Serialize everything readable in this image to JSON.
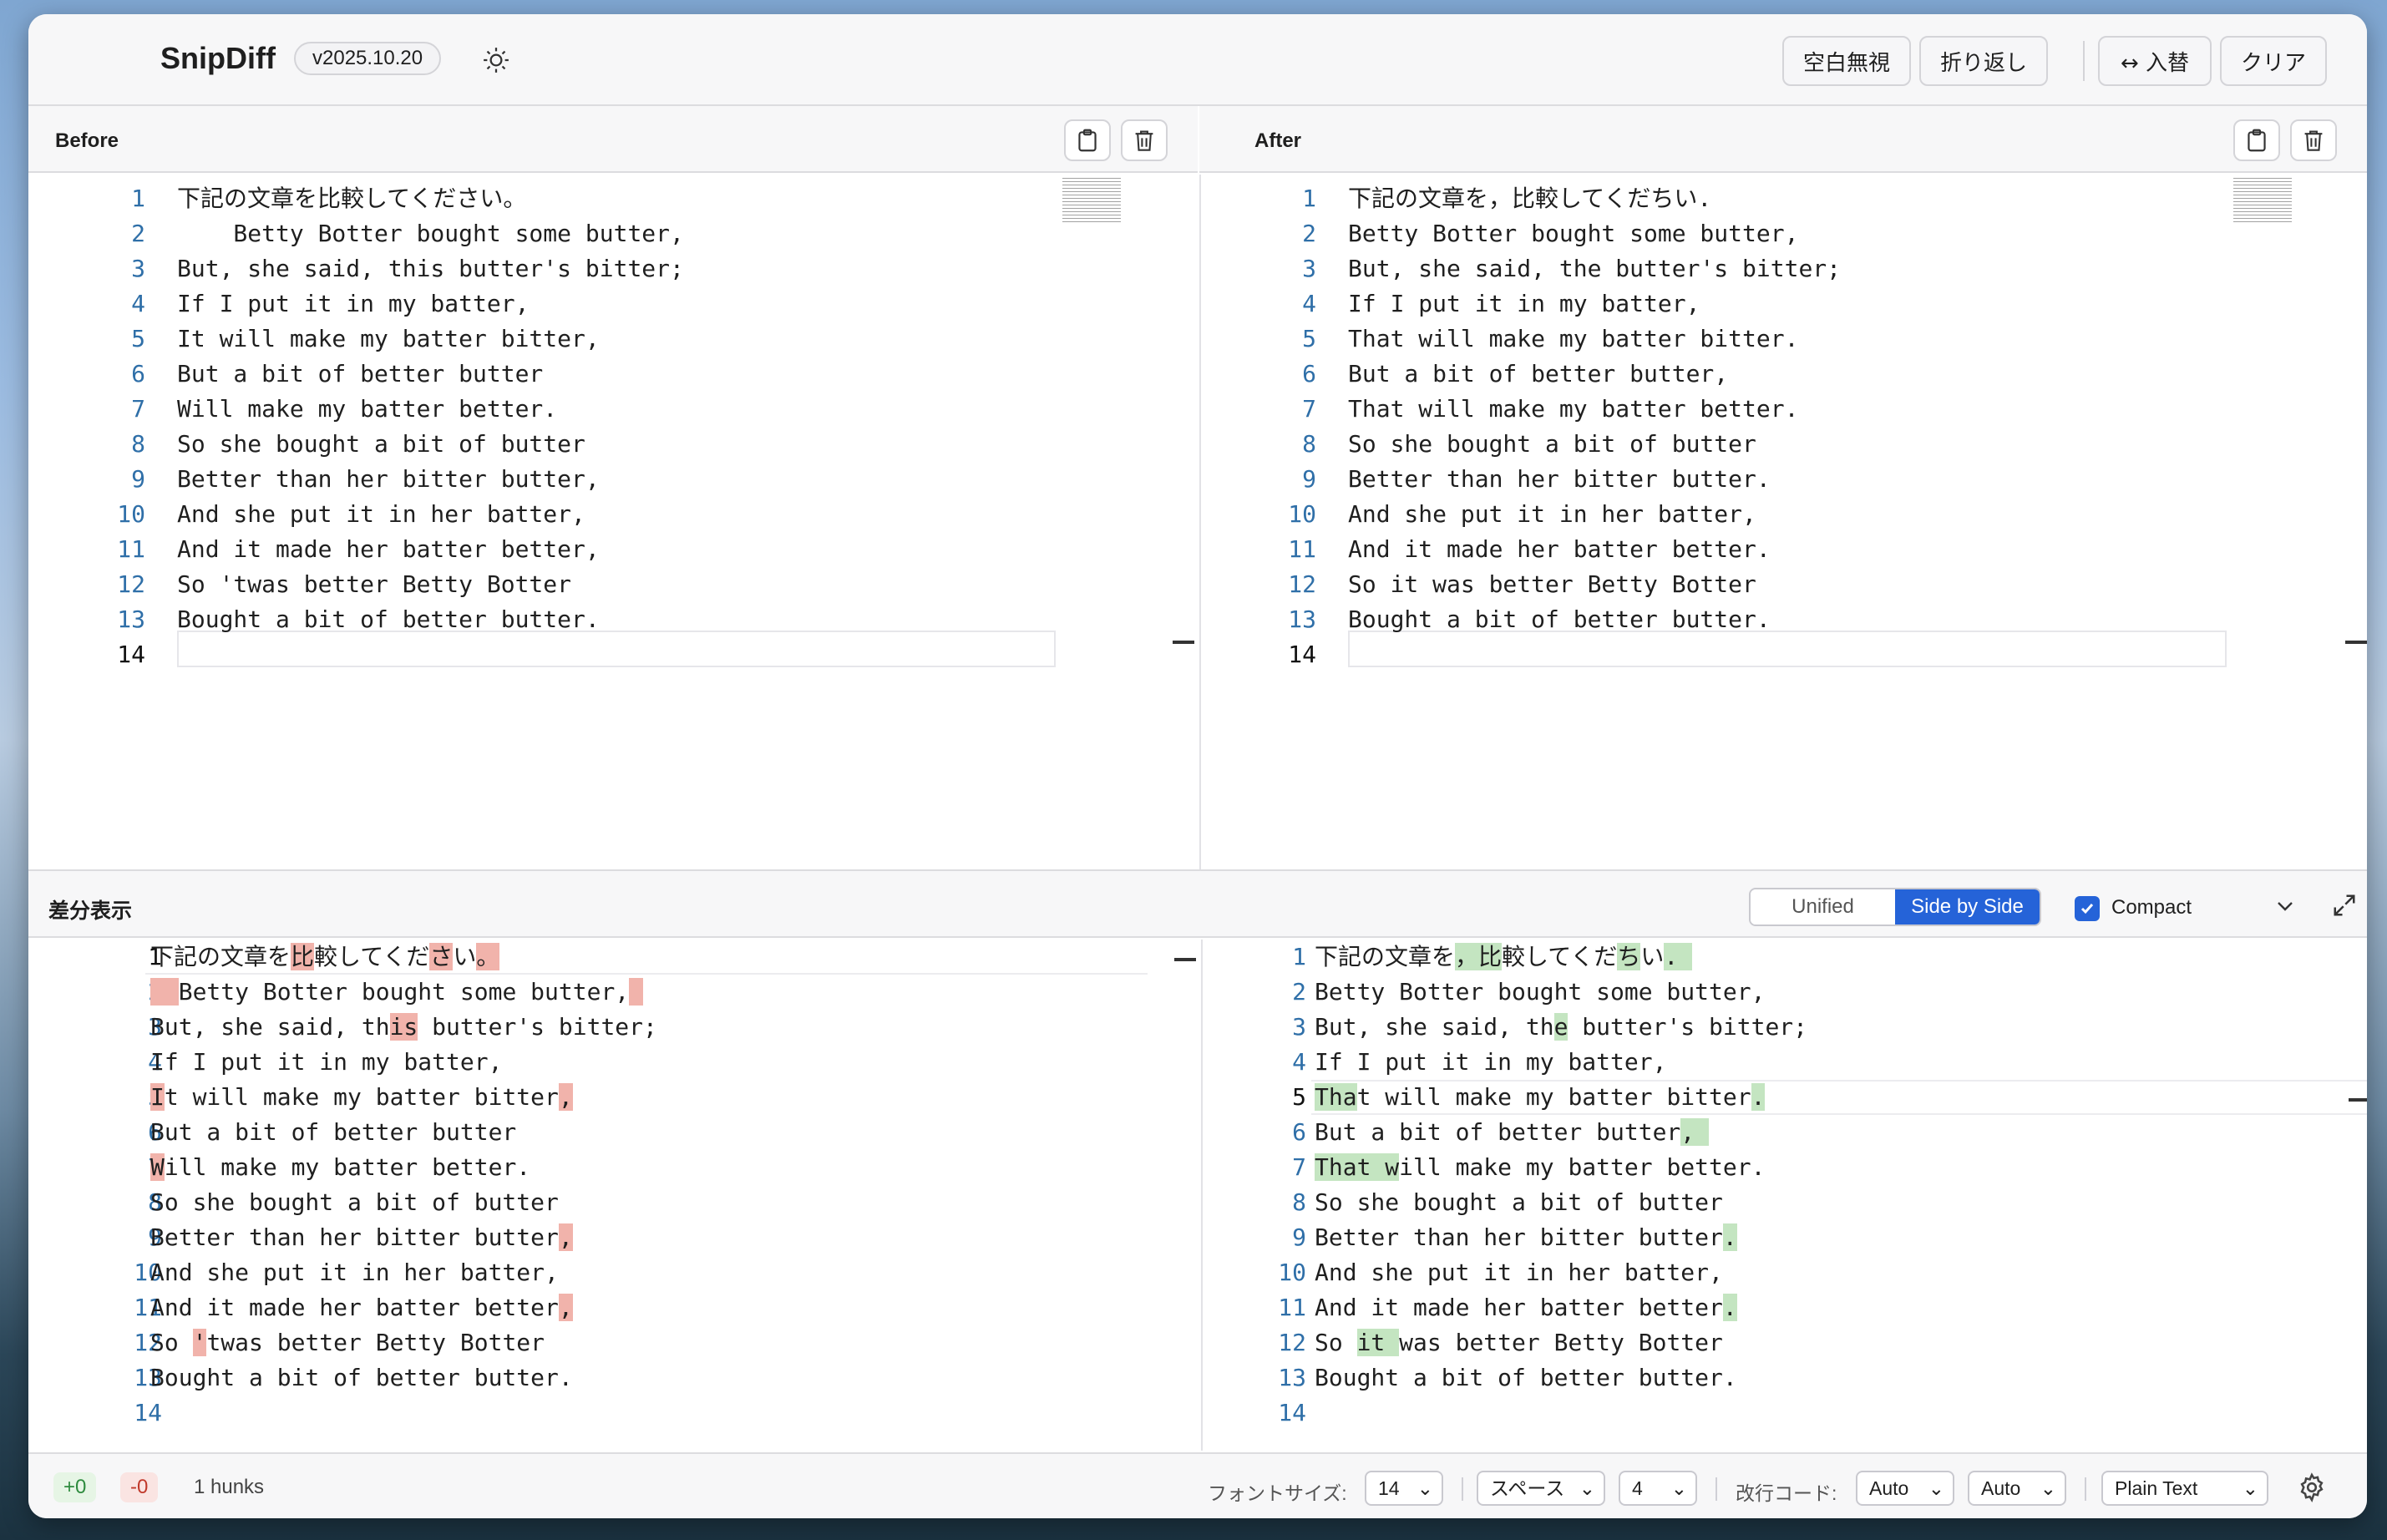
{
  "app": {
    "title": "SnipDiff",
    "version": "v2025.10.20"
  },
  "toolbar": {
    "ignore_whitespace": "空白無視",
    "wrap": "折り返し",
    "swap": "↔ 入替",
    "clear": "クリア"
  },
  "before": {
    "title": "Before",
    "lines": [
      "下記の文章を比較してください。",
      "    Betty Botter bought some butter,",
      "But, she said, this butter's bitter;",
      "If I put it in my batter,",
      "It will make my batter bitter,",
      "But a bit of better butter",
      "Will make my batter better.",
      "So she bought a bit of butter",
      "Better than her bitter butter,",
      "And she put it in her batter,",
      "And it made her batter better,",
      "So 'twas better Betty Botter",
      "Bought a bit of better butter.",
      ""
    ]
  },
  "after": {
    "title": "After",
    "lines": [
      "下記の文章を，比較してくだちい.",
      "Betty Botter bought some butter,",
      "But, she said, the butter's bitter;",
      "If I put it in my batter,",
      "That will make my batter bitter.",
      "But a bit of better butter,",
      "That will make my batter better.",
      "So she bought a bit of butter",
      "Better than her bitter butter.",
      "And she put it in her batter,",
      "And it made her batter better.",
      "So it was better Betty Botter",
      "Bought a bit of better butter.",
      ""
    ]
  },
  "diff": {
    "title": "差分表示",
    "mode_unified": "Unified",
    "mode_side": "Side by Side",
    "compact_label": "Compact",
    "left": [
      [
        [
          "下記の文章を",
          ""
        ],
        [
          "比",
          "d"
        ],
        [
          "較してくだ",
          ""
        ],
        [
          "さ",
          "d"
        ],
        [
          "い",
          ""
        ],
        [
          "。",
          "d"
        ]
      ],
      [
        [
          "  ",
          "d"
        ],
        [
          "Betty Botter bought some butter,",
          ""
        ],
        [
          " ",
          "d"
        ]
      ],
      [
        [
          "But, she said, th",
          ""
        ],
        [
          "is",
          "d"
        ],
        [
          " butter's bitter;",
          ""
        ]
      ],
      [
        [
          "If I put it in my batter,",
          ""
        ]
      ],
      [
        [
          "I",
          "d"
        ],
        [
          "t will make my batter bitter",
          ""
        ],
        [
          ",",
          "d"
        ]
      ],
      [
        [
          "But a bit of better butter",
          ""
        ]
      ],
      [
        [
          "W",
          "d"
        ],
        [
          "ill make my batter better.",
          ""
        ]
      ],
      [
        [
          "So she bought a bit of butter",
          ""
        ]
      ],
      [
        [
          "Better than her bitter butter",
          ""
        ],
        [
          ",",
          "d"
        ]
      ],
      [
        [
          "And she put it in her batter,",
          ""
        ]
      ],
      [
        [
          "And it made her batter better",
          ""
        ],
        [
          ",",
          "d"
        ]
      ],
      [
        [
          "So ",
          ""
        ],
        [
          "'",
          "d"
        ],
        [
          "twas better Betty Botter",
          ""
        ]
      ],
      [
        [
          "Bought a bit of better butter.",
          ""
        ]
      ],
      []
    ],
    "right": [
      [
        [
          "下記の文章を",
          ""
        ],
        [
          "，比",
          "a"
        ],
        [
          "較してくだ",
          ""
        ],
        [
          "ち",
          "a"
        ],
        [
          "い",
          ""
        ],
        [
          ". ",
          "a"
        ]
      ],
      [
        [
          "Betty Botter bought some butter,",
          ""
        ]
      ],
      [
        [
          "But, she said, th",
          ""
        ],
        [
          "e",
          "a"
        ],
        [
          " butter's bitter;",
          ""
        ]
      ],
      [
        [
          "If I put it in my batter,",
          ""
        ]
      ],
      [
        [
          "Tha",
          "a"
        ],
        [
          "t will make my batter bitter",
          ""
        ],
        [
          ".",
          "a"
        ]
      ],
      [
        [
          "But a bit of better butter",
          ""
        ],
        [
          ", ",
          "a"
        ]
      ],
      [
        [
          "That w",
          "a"
        ],
        [
          "ill make my batter better.",
          ""
        ]
      ],
      [
        [
          "So she bought a bit of butter",
          ""
        ]
      ],
      [
        [
          "Better than her bitter butter",
          ""
        ],
        [
          ".",
          "a"
        ]
      ],
      [
        [
          "And she put it in her batter,",
          ""
        ]
      ],
      [
        [
          "And it made her batter better",
          ""
        ],
        [
          ".",
          "a"
        ]
      ],
      [
        [
          "So ",
          ""
        ],
        [
          "it ",
          "a"
        ],
        [
          "was better Betty Botter",
          ""
        ]
      ],
      [
        [
          "Bought a bit of better butter.",
          ""
        ]
      ],
      []
    ]
  },
  "footer": {
    "added": "+0",
    "removed": "-0",
    "hunks": "1 hunks",
    "font_size_label": "フォントサイズ:",
    "font_size": "14",
    "indent_type": "スペース",
    "indent_size": "4",
    "eol_label": "改行コード:",
    "eol_in": "Auto",
    "eol_out": "Auto",
    "language": "Plain Text"
  },
  "colors": {
    "accent": "#2563d8",
    "deleted": "#f1b3ab",
    "added": "#c4e5c1"
  },
  "icons": [
    "sun-icon",
    "clipboard-icon",
    "trash-icon",
    "chevron-down-icon",
    "expand-icon",
    "gear-icon",
    "checkmark-icon"
  ]
}
